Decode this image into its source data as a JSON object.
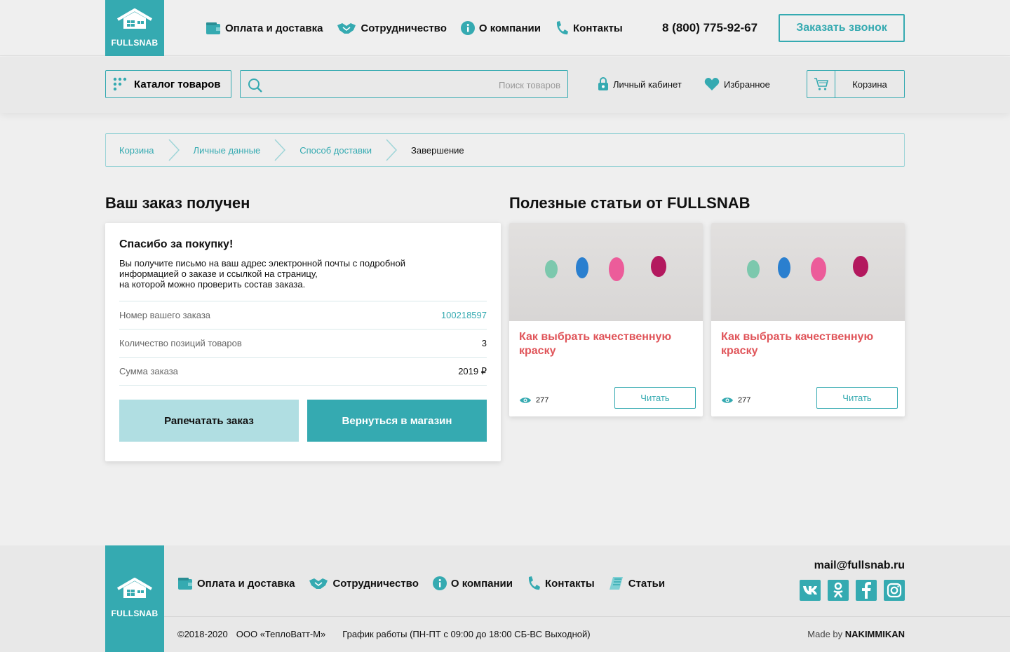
{
  "brand": {
    "name": "FULLSNAB"
  },
  "header": {
    "nav": [
      {
        "label": "Оплата и доставка",
        "icon": "wallet-icon"
      },
      {
        "label": "Сотрудничество",
        "icon": "handshake-icon"
      },
      {
        "label": "О компании",
        "icon": "info-icon"
      },
      {
        "label": "Контакты",
        "icon": "phone-icon"
      }
    ],
    "phone": "8 (800) 775-92-67",
    "callback_label": "Заказать звонок",
    "catalog_label": "Каталог товаров",
    "search_placeholder": "Поиск товаров",
    "cabinet_label": "Личный кабинет",
    "favorites_label": "Избранное",
    "cart_label": "Корзина"
  },
  "breadcrumb": [
    "Корзина",
    "Личные данные",
    "Способ доставки",
    "Завершение"
  ],
  "order": {
    "section_title": "Ваш заказ получен",
    "thanks": "Спасибо за покупку!",
    "description": "Вы получите письмо на ваш адрес электронной почты с подробной\nинформацией о заказе и ссылкой на страницу,\nна которой можно проверить состав заказа.",
    "rows": [
      {
        "label": "Номер вашего заказа",
        "value": "100218597"
      },
      {
        "label": "Количество позиций товаров",
        "value": "3"
      },
      {
        "label": "Сумма заказа",
        "value": "2019 ₽"
      }
    ],
    "print_label": "Рапечатать заказ",
    "back_label": "Вернуться в магазин"
  },
  "articles": {
    "section_title": "Полезные статьи от FULLSNAB",
    "items": [
      {
        "title": "Как выбрать качественную краску",
        "views": "277",
        "read_label": "Читать"
      },
      {
        "title": "Как выбрать качественную краску",
        "views": "277",
        "read_label": "Читать"
      }
    ]
  },
  "footer": {
    "nav": [
      {
        "label": "Оплата и доставка",
        "icon": "wallet-icon"
      },
      {
        "label": "Сотрудничество",
        "icon": "handshake-icon"
      },
      {
        "label": "О компании",
        "icon": "info-icon"
      },
      {
        "label": "Контакты",
        "icon": "phone-icon"
      },
      {
        "label": "Статьи",
        "icon": "articles-icon"
      }
    ],
    "email": "mail@fullsnab.ru",
    "socials": [
      "vk-icon",
      "odnoklassniki-icon",
      "facebook-icon",
      "instagram-icon"
    ],
    "copyright": "©2018-2020",
    "company": "ООО «ТеплоВатт-М»",
    "schedule": "График работы (ПН-ПТ с 09:00 до 18:00 СБ-ВС Выходной)",
    "made_by_prefix": "Made by",
    "made_by_name": "NAKIMMIKAN"
  },
  "colors": {
    "accent": "#35aab1",
    "accent_light": "#b0dee2",
    "article_title": "#e0555a",
    "background": "#efefef"
  }
}
